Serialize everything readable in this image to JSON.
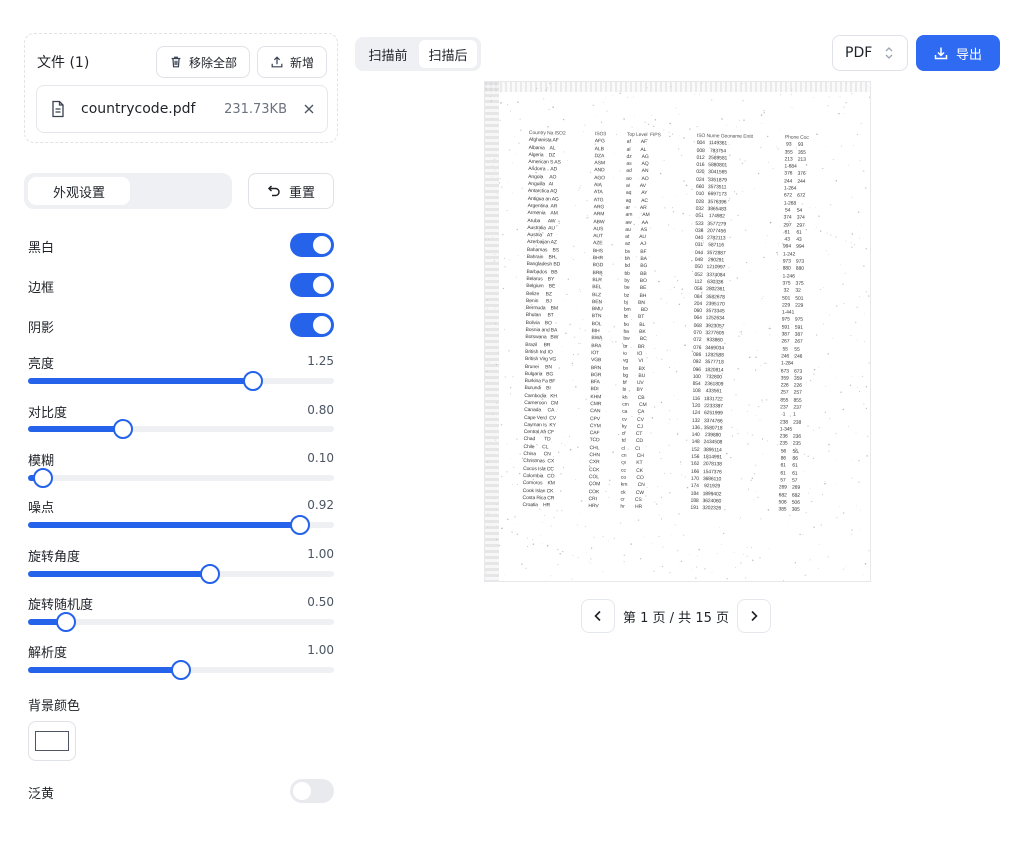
{
  "files": {
    "title": "文件 (1)",
    "remove_all_label": "移除全部",
    "add_label": "新增",
    "items": [
      {
        "name": "countrycode.pdf",
        "size": "231.73KB"
      }
    ]
  },
  "settings": {
    "tab_label": "外观设置",
    "reset_label": "重置",
    "toggles": [
      {
        "label": "黑白",
        "on": true
      },
      {
        "label": "边框",
        "on": true
      },
      {
        "label": "阴影",
        "on": true
      }
    ],
    "sliders": [
      {
        "label": "亮度",
        "value": "1.25",
        "fraction": 0.735
      },
      {
        "label": "对比度",
        "value": "0.80",
        "fraction": 0.31
      },
      {
        "label": "模糊",
        "value": "0.10",
        "fraction": 0.05
      },
      {
        "label": "噪点",
        "value": "0.92",
        "fraction": 0.89
      },
      {
        "label": "旋转角度",
        "value": "1.00",
        "fraction": 0.595
      },
      {
        "label": "旋转随机度",
        "value": "0.50",
        "fraction": 0.125
      },
      {
        "label": "解析度",
        "value": "1.00",
        "fraction": 0.5
      }
    ],
    "bg_color_label": "背景颜色",
    "bg_color": "#ffffff",
    "yellowing_label": "泛黄",
    "yellowing_on": false
  },
  "view": {
    "before_label": "扫描前",
    "after_label": "扫描后",
    "active": "after"
  },
  "export": {
    "format": "PDF",
    "label": "导出"
  },
  "pagination": {
    "text": "第 1 页 / 共 15 页"
  },
  "colors": {
    "accent": "#2563eb",
    "export_bg": "#2f6bf2"
  }
}
